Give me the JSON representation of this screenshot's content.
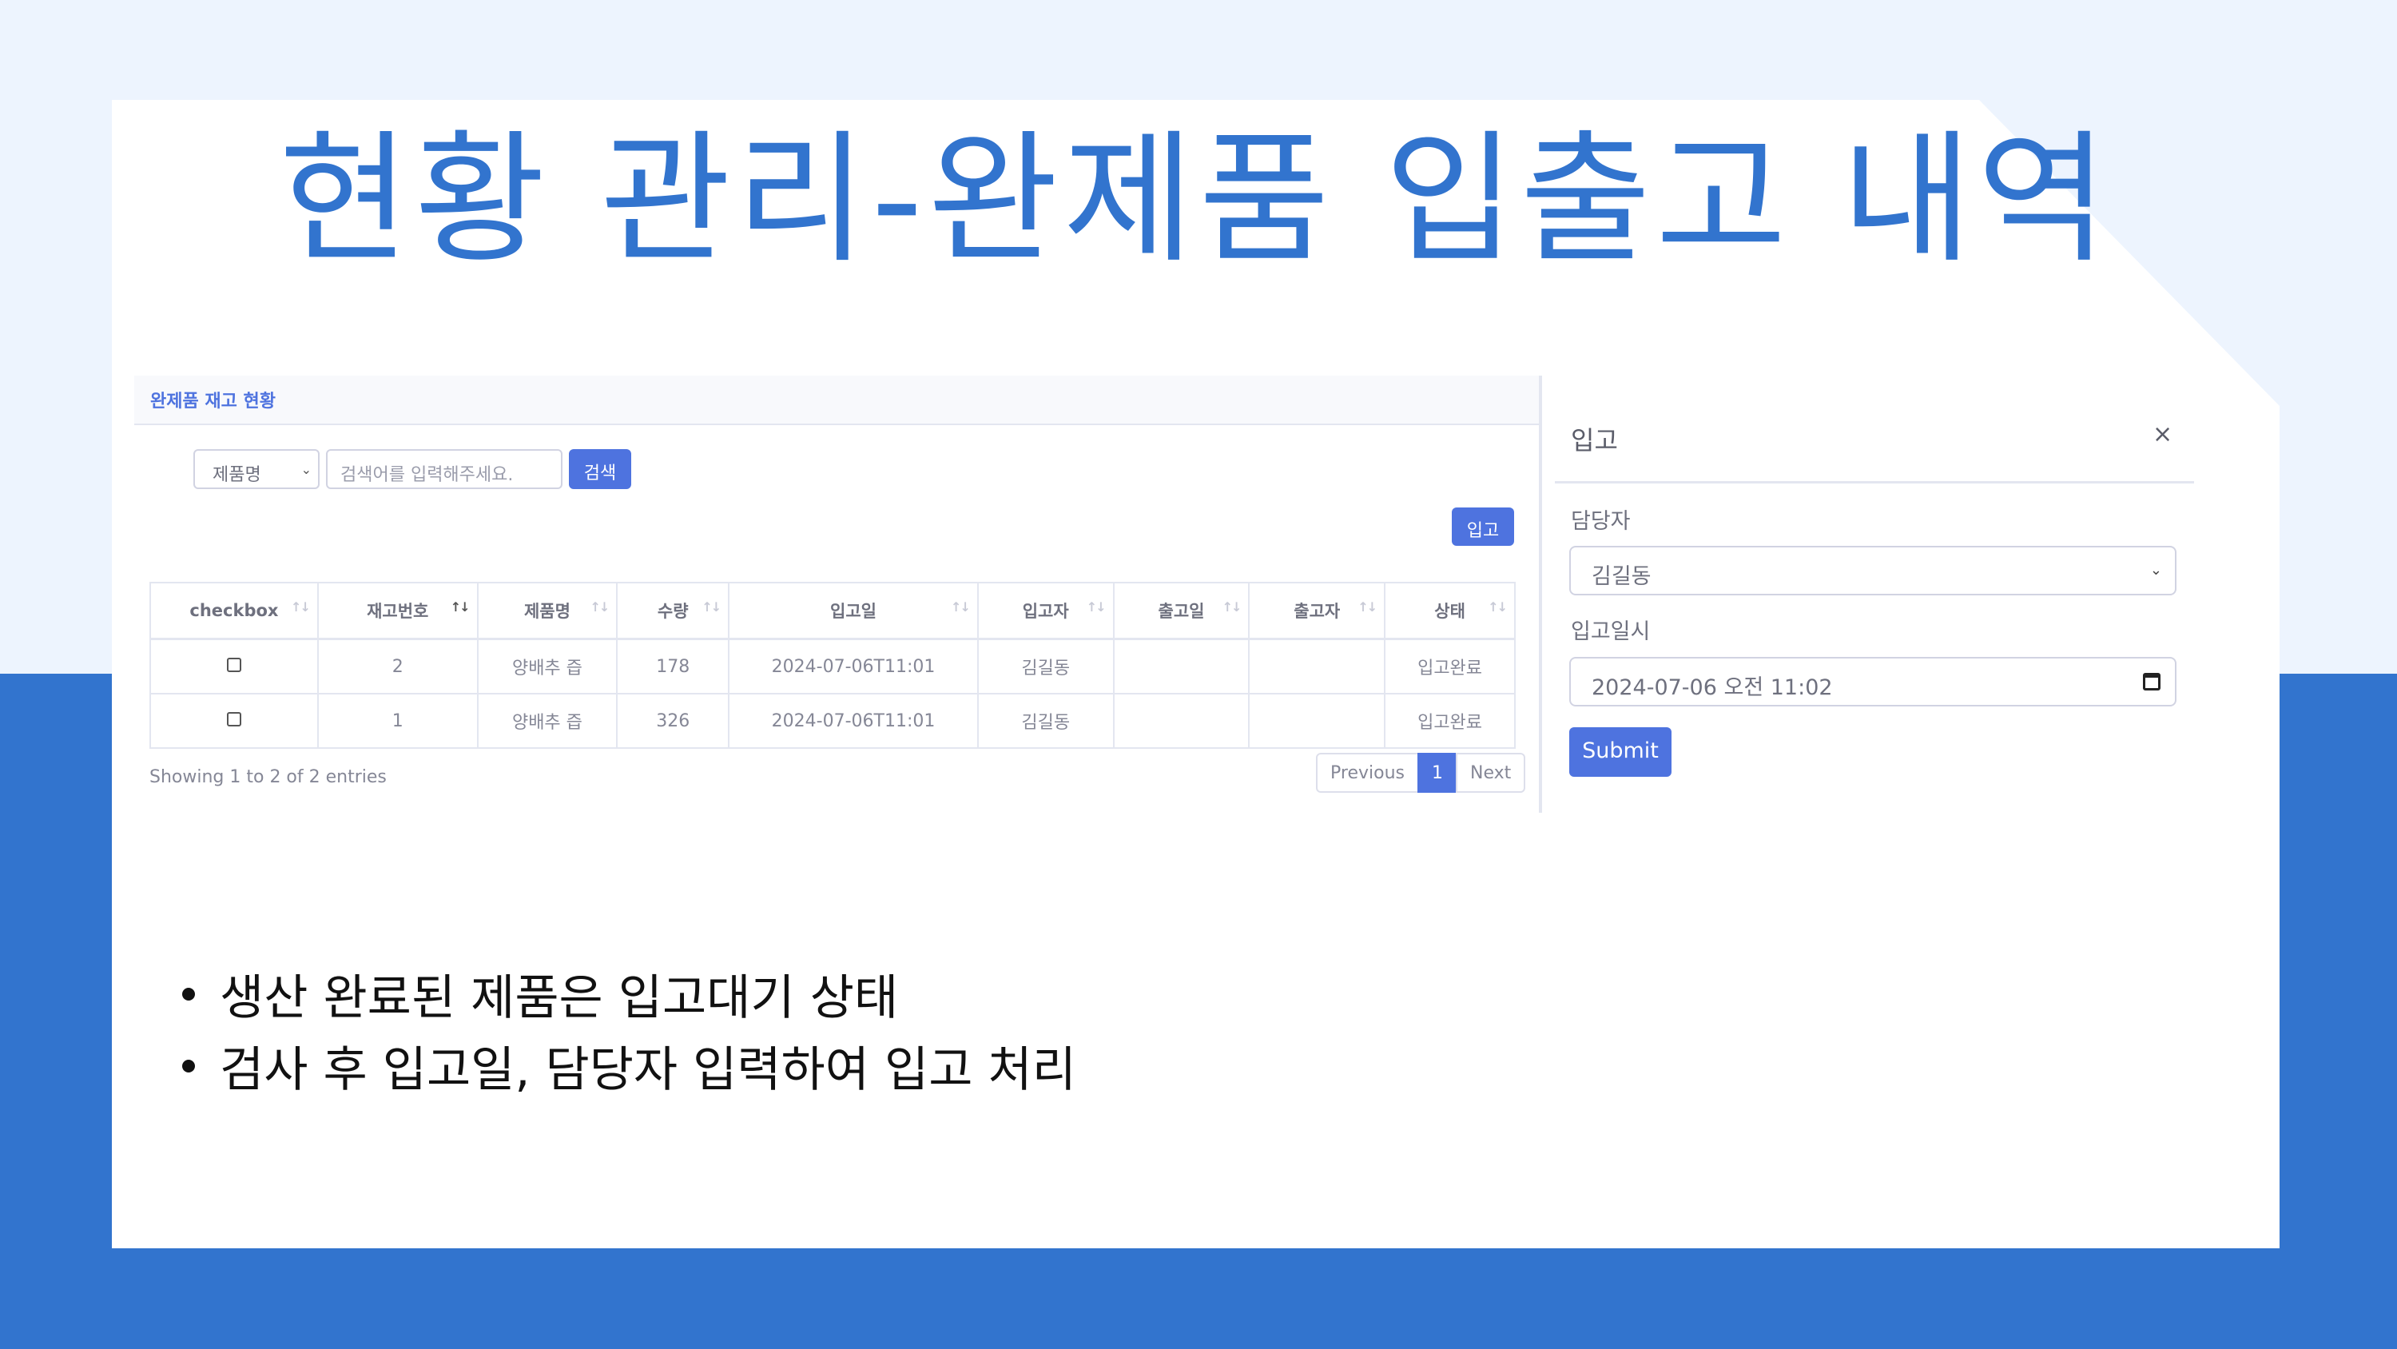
{
  "slide": {
    "title": "현황 관리-완제품 입출고 내역",
    "bullets": [
      "생산 완료된 제품은 입고대기 상태",
      " 검사 후 입고일, 담당자 입력하여 입고 처리"
    ]
  },
  "inventory": {
    "card_title": "완제품 재고 현황",
    "filter_select": "제품명",
    "search_placeholder": "검색어를 입력해주세요.",
    "search_button": "검색",
    "add_button": "입고",
    "columns": [
      "checkbox",
      "재고번호",
      "제품명",
      "수량",
      "입고일",
      "입고자",
      "출고일",
      "출고자",
      "상태"
    ],
    "rows": [
      {
        "id": "2",
        "product": "양배추 즙",
        "qty": "178",
        "in_date": "2024-07-06T11:01",
        "in_user": "김길동",
        "out_date": "",
        "out_user": "",
        "status": "입고완료"
      },
      {
        "id": "1",
        "product": "양배추 즙",
        "qty": "326",
        "in_date": "2024-07-06T11:01",
        "in_user": "김길동",
        "out_date": "",
        "out_user": "",
        "status": "입고완료"
      }
    ],
    "info": "Showing 1 to 2 of 2 entries",
    "pagination": {
      "prev": "Previous",
      "current": "1",
      "next": "Next"
    }
  },
  "modal": {
    "title": "입고",
    "close": "×",
    "manager_label": "담당자",
    "manager_value": "김길동",
    "datetime_label": "입고일시",
    "datetime_value": "2024-07-06 오전 11:02",
    "submit": "Submit"
  },
  "colors": {
    "accent": "#3274ce",
    "button": "#4e73df",
    "background": "#edf4fe"
  }
}
